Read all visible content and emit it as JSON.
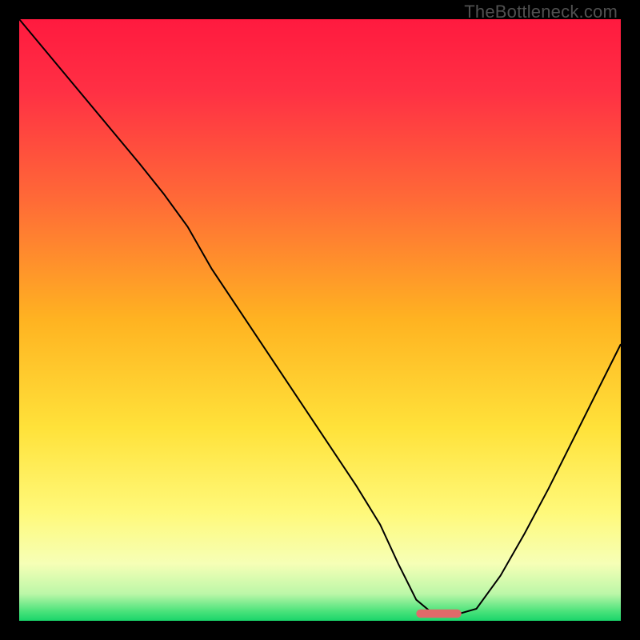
{
  "watermark": "TheBottleneck.com",
  "chart_data": {
    "type": "line",
    "title": "",
    "xlabel": "",
    "ylabel": "",
    "xlim": [
      0,
      100
    ],
    "ylim": [
      0,
      100
    ],
    "axes_visible": false,
    "grid": false,
    "background_gradient_note": "vertical gradient from red (top) through orange/yellow to green (bottom)",
    "gradient_stops": [
      {
        "pos": 0.0,
        "color": "#ff1a3f"
      },
      {
        "pos": 0.12,
        "color": "#ff3044"
      },
      {
        "pos": 0.3,
        "color": "#ff6a37"
      },
      {
        "pos": 0.5,
        "color": "#ffb321"
      },
      {
        "pos": 0.68,
        "color": "#ffe23a"
      },
      {
        "pos": 0.82,
        "color": "#fff97a"
      },
      {
        "pos": 0.905,
        "color": "#f6ffb6"
      },
      {
        "pos": 0.955,
        "color": "#bcf7a8"
      },
      {
        "pos": 0.985,
        "color": "#48e27a"
      },
      {
        "pos": 1.0,
        "color": "#19d56a"
      }
    ],
    "series": [
      {
        "name": "bottleneck-curve",
        "stroke": "#000000",
        "stroke_width": 2,
        "x": [
          0.0,
          5.0,
          10.0,
          15.0,
          20.0,
          24.0,
          28.0,
          32.0,
          36.0,
          40.0,
          44.0,
          48.0,
          52.0,
          56.0,
          60.0,
          63.0,
          66.0,
          69.0,
          72.5,
          76.0,
          80.0,
          84.0,
          88.0,
          92.0,
          96.0,
          100.0
        ],
        "y": [
          100.0,
          94.0,
          88.0,
          82.0,
          76.0,
          71.0,
          65.5,
          58.5,
          52.5,
          46.5,
          40.5,
          34.5,
          28.5,
          22.5,
          16.0,
          9.5,
          3.5,
          1.0,
          1.0,
          2.0,
          7.5,
          14.5,
          22.0,
          30.0,
          38.0,
          46.0
        ]
      }
    ],
    "markers": [
      {
        "name": "optimal-range-marker",
        "shape": "rounded-bar",
        "color": "#e06a6a",
        "x_start": 66.0,
        "x_end": 73.5,
        "y": 1.2,
        "height_pct": 1.4
      }
    ]
  }
}
